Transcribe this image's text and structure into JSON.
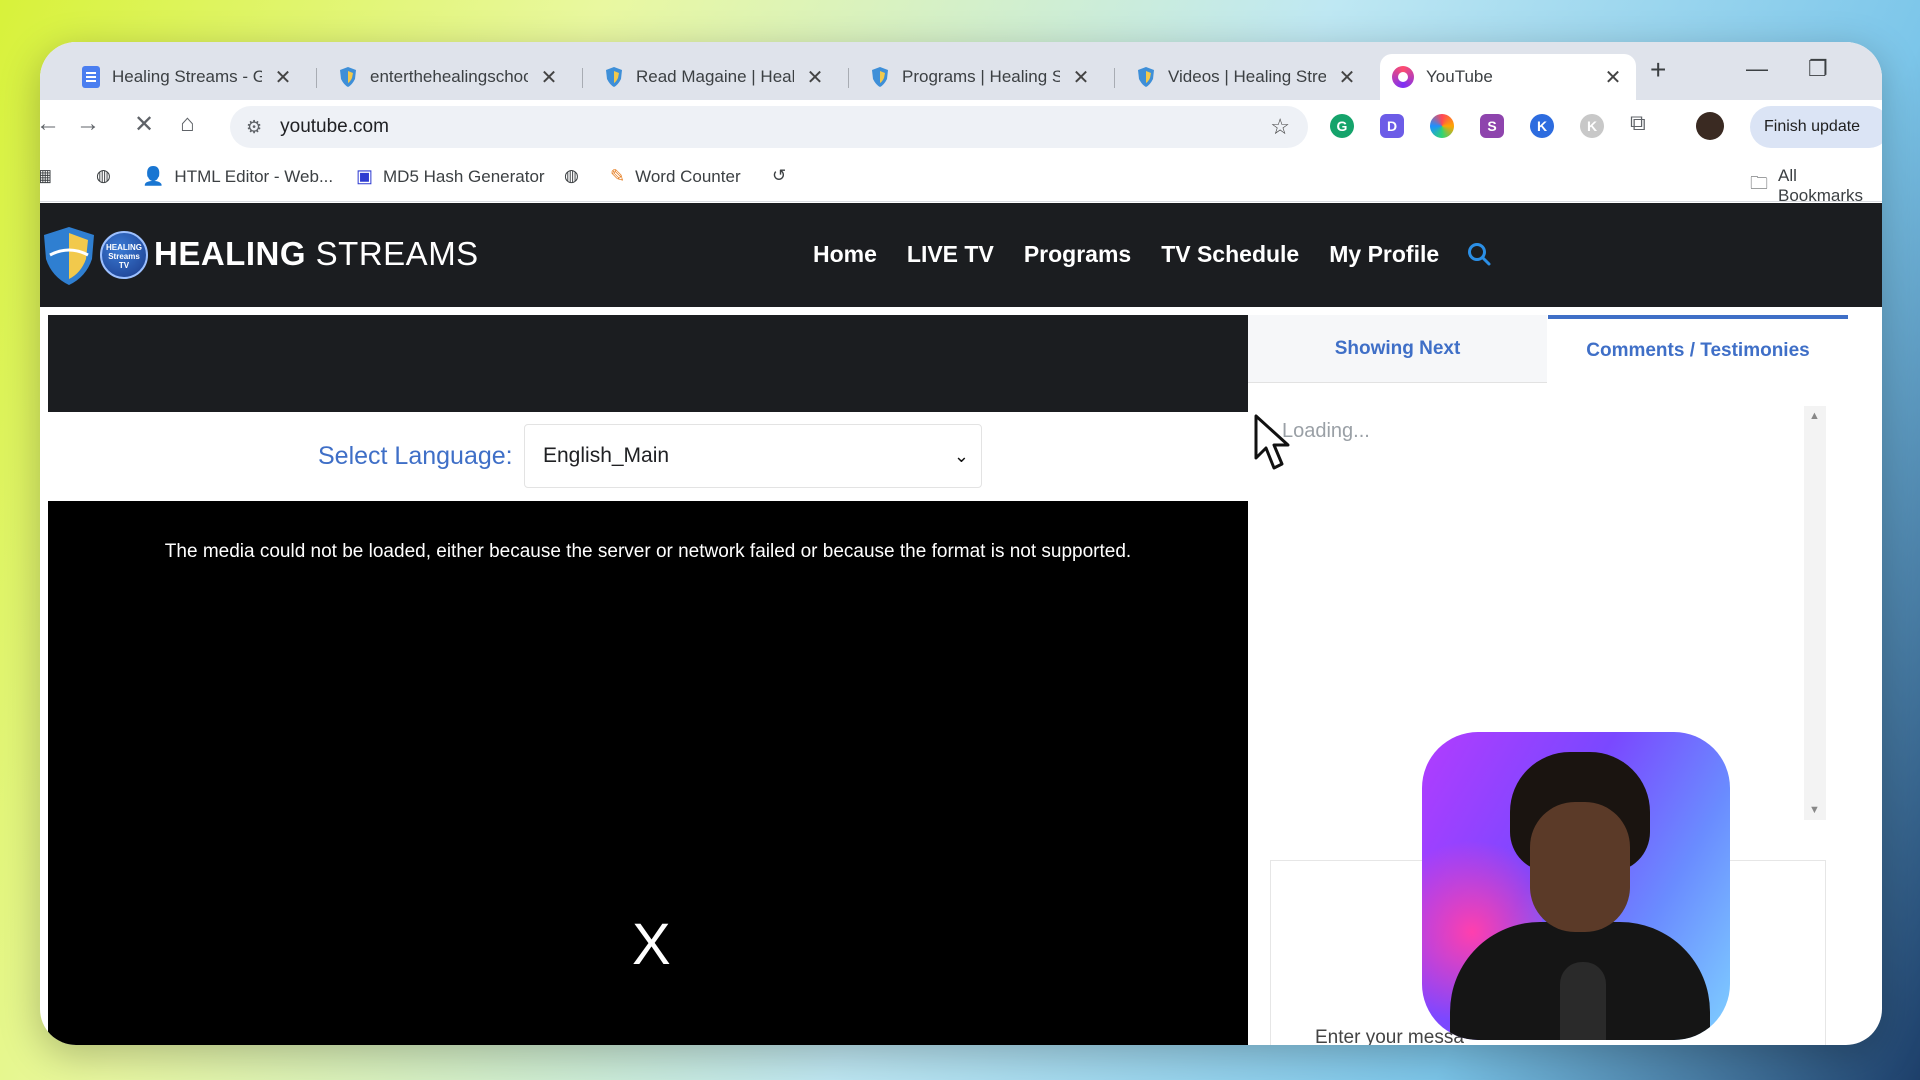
{
  "browser": {
    "tabs": [
      {
        "title": "Healing Streams - Go",
        "icon": "docs-icon",
        "active": false
      },
      {
        "title": "enterthehealingschoo",
        "icon": "shield-icon",
        "active": false
      },
      {
        "title": "Read Magaine | Heali",
        "icon": "shield-icon",
        "active": false
      },
      {
        "title": "Programs | Healing S",
        "icon": "shield-icon",
        "active": false
      },
      {
        "title": "Videos | Healing Stre",
        "icon": "shield-icon",
        "active": false
      },
      {
        "title": "YouTube",
        "icon": "youtube-icon",
        "active": true
      }
    ],
    "address": "youtube.com",
    "finish_update": "Finish update",
    "bookmarks": [
      {
        "label": "HTML Editor - Web..."
      },
      {
        "label": "MD5 Hash Generator"
      },
      {
        "label": "Word Counter"
      }
    ],
    "all_bookmarks": "All Bookmarks"
  },
  "site": {
    "logo_badge": "HEALING Streams TV",
    "logo_bold": "HEALING",
    "logo_light": "STREAMS",
    "nav": [
      "Home",
      "LIVE TV",
      "Programs",
      "TV Schedule",
      "My Profile"
    ]
  },
  "player": {
    "language_label": "Select Language:",
    "language_value": "English_Main",
    "error_message": "The media could not be loaded, either because the server or network failed or because the format is not supported.",
    "close_label": "X"
  },
  "panel": {
    "tab_next": "Showing Next",
    "tab_comments": "Comments / Testimonies",
    "loading": "Loading...",
    "message_placeholder": "Enter your messa"
  },
  "colors": {
    "accent": "#3f6fc7",
    "header_bg": "#1b1d20"
  }
}
